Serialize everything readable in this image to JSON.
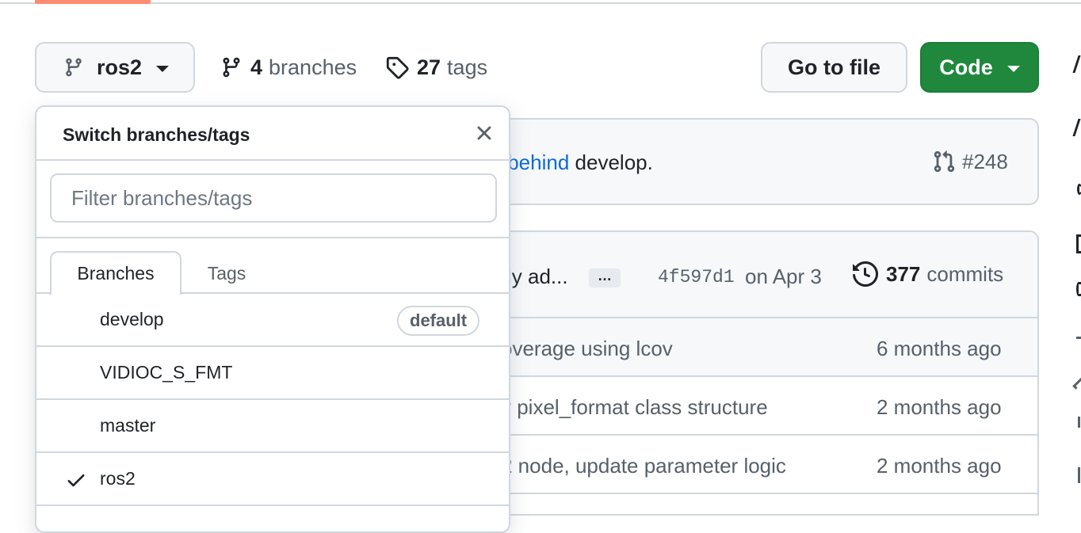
{
  "header": {
    "branch_selector": {
      "label": "ros2"
    },
    "branches": {
      "count": "4",
      "label": "branches"
    },
    "tags": {
      "count": "27",
      "label": "tags"
    },
    "goto_file_label": "Go to file",
    "code_label": "Code"
  },
  "banner": {
    "link_fragment": "s behind",
    "text_after": " develop.",
    "pr_ref": "#248"
  },
  "latest_commit": {
    "message_fragment": "ly ad...",
    "ellipsis": "…",
    "sha": "4f597d1",
    "date": "on Apr 3",
    "commit_count": "377",
    "commit_label": "commits"
  },
  "file_rows": [
    {
      "message": "overage using lcov",
      "age": "6 months ago"
    },
    {
      "message": "v pixel_format class structure",
      "age": "2 months ago"
    },
    {
      "message": "2 node, update parameter logic",
      "age": "2 months ago"
    }
  ],
  "dropdown": {
    "title": "Switch branches/tags",
    "filter_placeholder": "Filter branches/tags",
    "tabs": {
      "branches": "Branches",
      "tags": "Tags"
    },
    "branches": [
      {
        "name": "develop",
        "badge": "default",
        "selected": false
      },
      {
        "name": "VIDIOC_S_FMT",
        "badge": "",
        "selected": false
      },
      {
        "name": "master",
        "badge": "",
        "selected": false
      },
      {
        "name": "ros2",
        "badge": "",
        "selected": true
      }
    ]
  },
  "colors": {
    "accent_underline": "#fd8c73",
    "code_button": "#1f883d",
    "link": "#0969da"
  },
  "icons": {
    "branch": "git-branch-icon",
    "tag": "tag-icon",
    "pull_request": "git-pull-request-icon",
    "history": "history-icon",
    "close": "x-icon",
    "check": "check-icon"
  }
}
